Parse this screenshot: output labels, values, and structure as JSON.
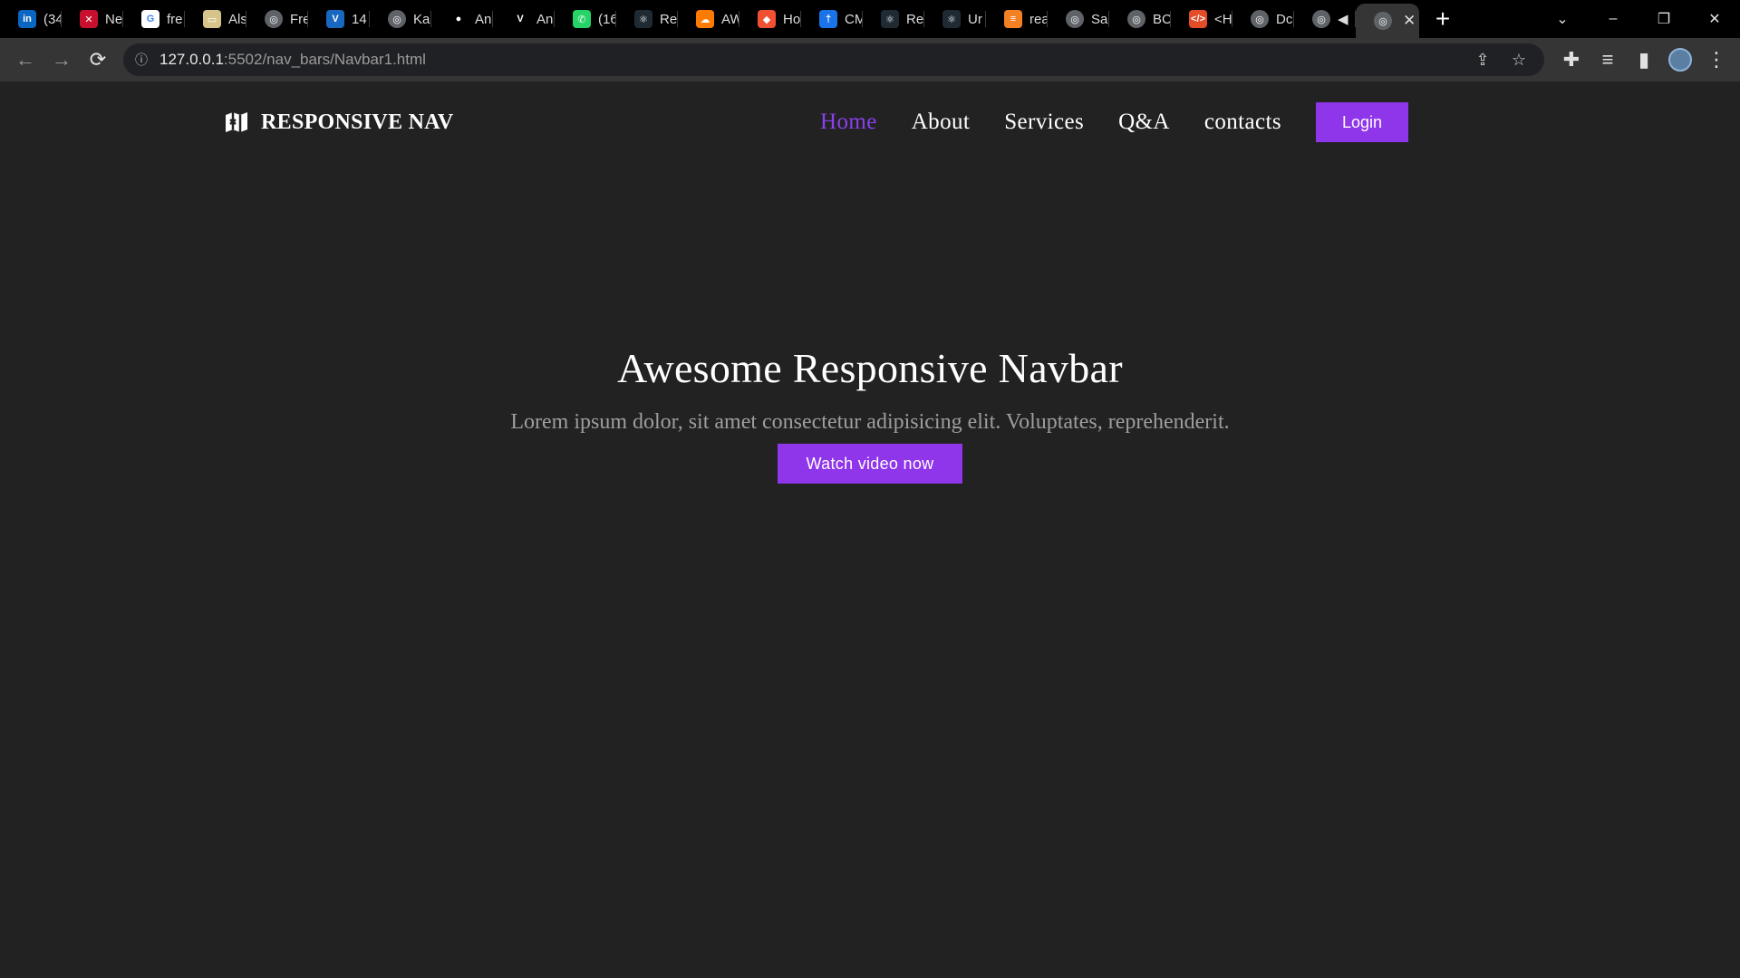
{
  "browser": {
    "tabs": [
      {
        "title": "(34",
        "icon": "linkedin-icon",
        "color": "#0a66c2",
        "glyph": "in"
      },
      {
        "title": "Ne",
        "icon": "netlify-fox-icon",
        "color": "#c8102e",
        "glyph": "✕"
      },
      {
        "title": "fre",
        "icon": "google-icon",
        "color": "#ffffff",
        "glyph": "G"
      },
      {
        "title": "Als",
        "icon": "card-icon",
        "color": "#d6c48a",
        "glyph": "▭"
      },
      {
        "title": "Fre",
        "icon": "globe-icon",
        "color": "#5f6368",
        "glyph": "◎"
      },
      {
        "title": "14",
        "icon": "vuetify-icon",
        "color": "#1867c0",
        "glyph": "V"
      },
      {
        "title": "Kal",
        "icon": "globe-icon",
        "color": "#5f6368",
        "glyph": "◎"
      },
      {
        "title": "An",
        "icon": "github-icon",
        "color": "#000000",
        "glyph": "●"
      },
      {
        "title": "An",
        "icon": "vercel-icon",
        "color": "#000000",
        "glyph": "V"
      },
      {
        "title": "(16",
        "icon": "whatsapp-icon",
        "color": "#25d366",
        "glyph": "✆"
      },
      {
        "title": "Re",
        "icon": "react-icon",
        "color": "#1f2a33",
        "glyph": "⚛"
      },
      {
        "title": "AW",
        "icon": "cloud-icon",
        "color": "#ff7a00",
        "glyph": "☁"
      },
      {
        "title": "Ho",
        "icon": "git-icon",
        "color": "#f05133",
        "glyph": "◆"
      },
      {
        "title": "CM",
        "icon": "accessibility-icon",
        "color": "#1a73e8",
        "glyph": "†"
      },
      {
        "title": "Re",
        "icon": "react-icon",
        "color": "#1f2a33",
        "glyph": "⚛"
      },
      {
        "title": "Ur",
        "icon": "react-icon",
        "color": "#1f2a33",
        "glyph": "⚛"
      },
      {
        "title": "rea",
        "icon": "stackoverflow-icon",
        "color": "#f48024",
        "glyph": "≡"
      },
      {
        "title": "Sa",
        "icon": "globe-icon",
        "color": "#5f6368",
        "glyph": "◎"
      },
      {
        "title": "BC",
        "icon": "globe-icon",
        "color": "#5f6368",
        "glyph": "◎"
      },
      {
        "title": "<H",
        "icon": "html-code-icon",
        "color": "#e34c26",
        "glyph": "</>"
      },
      {
        "title": "Dc",
        "icon": "globe-icon",
        "color": "#5f6368",
        "glyph": "◎"
      },
      {
        "title": "◀",
        "icon": "globe-icon",
        "color": "#5f6368",
        "glyph": "◎"
      }
    ],
    "active_tab": {
      "icon": "globe-icon",
      "close": "✕"
    },
    "new_tab": "+",
    "window_controls": {
      "tab_search": "⌄",
      "minimize": "–",
      "restore": "❐",
      "close": "✕"
    },
    "url_host": "127.0.0.1",
    "url_rest": ":5502/nav_bars/Navbar1.html"
  },
  "page": {
    "logo_text": "RESPONSIVE NAV",
    "nav": [
      {
        "label": "Home",
        "active": true
      },
      {
        "label": "About",
        "active": false
      },
      {
        "label": "Services",
        "active": false
      },
      {
        "label": "Q&A",
        "active": false
      },
      {
        "label": "contacts",
        "active": false
      }
    ],
    "login_label": "Login",
    "hero_title": "Awesome Responsive Navbar",
    "hero_text": "Lorem ipsum dolor, sit amet consectetur adipisicing elit. Voluptates, reprehenderit.",
    "cta_label": "Watch video now",
    "colors": {
      "accent": "#8f35ea",
      "background": "#222222",
      "text": "#ffffff",
      "muted": "#9e9e9e"
    }
  }
}
